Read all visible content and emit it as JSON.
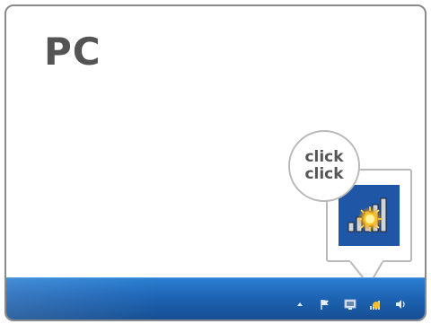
{
  "title": "PC",
  "callout": {
    "line1": "click",
    "line2": "click"
  },
  "colors": {
    "taskbar": "#1f67b8",
    "zoom_background": "#1f57a6",
    "title_text": "#545454"
  },
  "tray": {
    "icons": [
      "show-hidden-icons-arrow",
      "action-center-flag-icon",
      "display-icon",
      "network-icon",
      "volume-icon"
    ]
  },
  "zoom": {
    "icon": "wireless-network-icon"
  }
}
